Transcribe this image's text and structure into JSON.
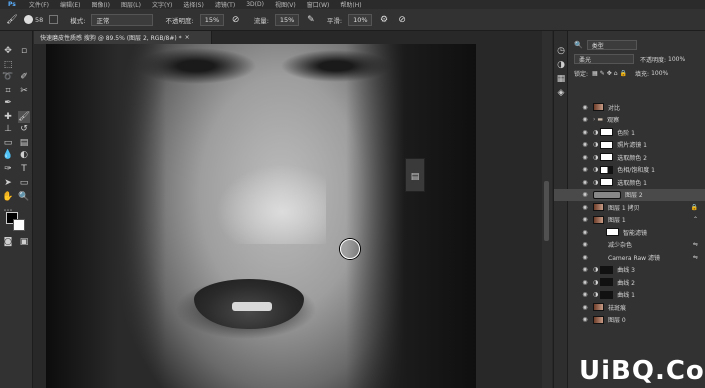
{
  "menubar": {
    "items": [
      "文件(F)",
      "编辑(E)",
      "图像(I)",
      "图层(L)",
      "文字(Y)",
      "选择(S)",
      "滤镜(T)",
      "3D(D)",
      "视图(V)",
      "窗口(W)",
      "帮助(H)"
    ]
  },
  "options": {
    "mode_label": "模式:",
    "mode_value": "正常",
    "opacity_label": "不透明度:",
    "opacity_value": "15%",
    "flow_label": "流量:",
    "flow_value": "15%",
    "smooth_label": "平滑:",
    "smooth_value": "10%",
    "brush_size": "58"
  },
  "document": {
    "tab_title": "快速磨皮性质感 搜狗 @ 89.5% (图层 2, RGB/8#) *",
    "tab_close": "×"
  },
  "layers_panel": {
    "filter_kind": "类型",
    "blend_mode": "柔光",
    "opacity_label": "不透明度:",
    "opacity_value": "100%",
    "lock_label": "锁定:",
    "fill_label": "填充:",
    "fill_value": "100%",
    "layers": [
      {
        "name": "对比",
        "thumb": "photo"
      },
      {
        "name": "观察",
        "thumb": "folder"
      },
      {
        "name": "色阶 1",
        "thumb": "white"
      },
      {
        "name": "照片滤镜 1",
        "thumb": "white"
      },
      {
        "name": "选取颜色 2",
        "thumb": "white"
      },
      {
        "name": "色相/饱和度 1",
        "thumb": "white"
      },
      {
        "name": "选取颜色 1",
        "thumb": "white"
      },
      {
        "name": "图层 2",
        "thumb": "selected"
      },
      {
        "name": "图层 1 拷贝",
        "thumb": "photo"
      },
      {
        "name": "图层 1",
        "thumb": "photo"
      },
      {
        "name": "智能滤镜",
        "thumb": "white"
      },
      {
        "name": "减少杂色",
        "thumb": "none"
      },
      {
        "name": "Camera Raw 滤镜",
        "thumb": "none"
      },
      {
        "name": "曲线 3",
        "thumb": "dark"
      },
      {
        "name": "曲线 2",
        "thumb": "dark"
      },
      {
        "name": "曲线 1",
        "thumb": "dark"
      },
      {
        "name": "祛斑痕",
        "thumb": "photo"
      },
      {
        "name": "图层 0",
        "thumb": "photo"
      }
    ]
  },
  "watermark": "UiBQ.CoM",
  "icons": [
    "brush-icon",
    "move-icon",
    "marquee-icon",
    "lasso-icon",
    "quick-select-icon",
    "crop-icon",
    "eyedropper-icon",
    "healing-icon",
    "brush-tool-icon",
    "stamp-icon",
    "history-brush-icon",
    "eraser-icon",
    "gradient-icon",
    "blur-icon",
    "dodge-icon",
    "pen-icon",
    "type-icon",
    "path-select-icon",
    "rectangle-icon",
    "hand-icon",
    "zoom-icon",
    "eye-icon",
    "gear-icon"
  ]
}
